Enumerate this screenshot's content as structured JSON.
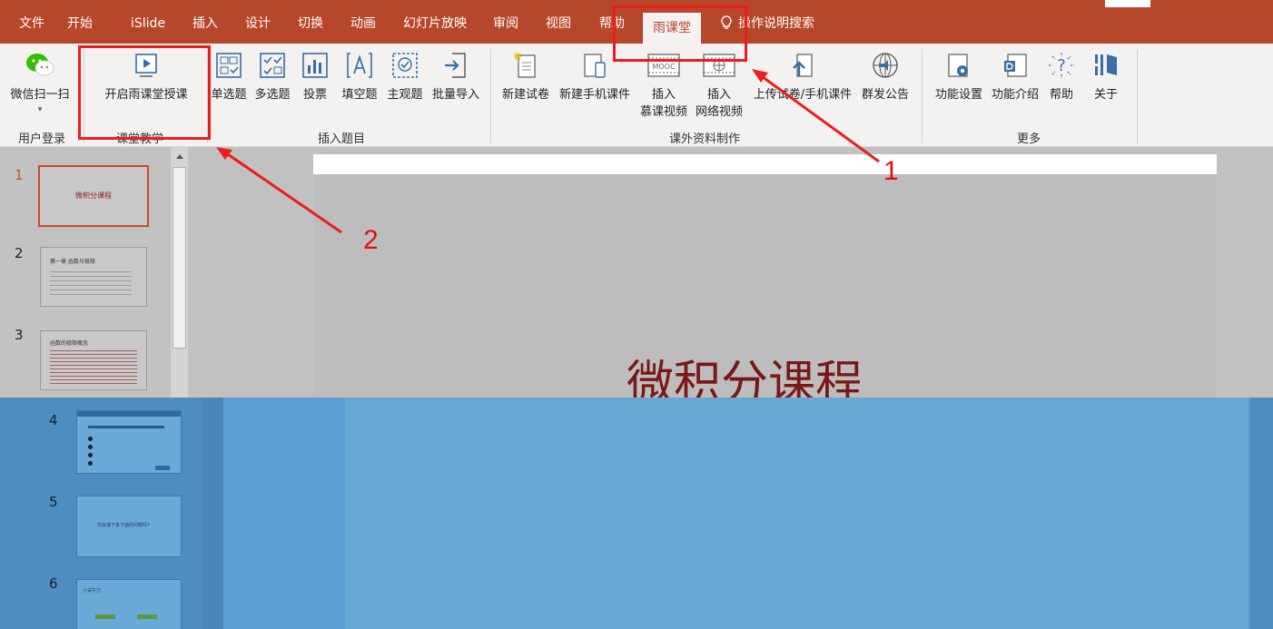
{
  "menu": {
    "tabs": [
      "文件",
      "开始",
      "iSlide",
      "插入",
      "设计",
      "切换",
      "动画",
      "幻灯片放映",
      "审阅",
      "视图",
      "帮助"
    ],
    "active_tab": "雨课堂",
    "tell_me": "操作说明搜索"
  },
  "ribbon": {
    "groups": {
      "login": "用户登录",
      "teaching": "课堂教学",
      "insert_questions": "插入题目",
      "materials": "课外资料制作",
      "more": "更多"
    },
    "buttons": {
      "wechat_scan": "微信扫一扫",
      "start_class": "开启雨课堂授课",
      "single_choice": "单选题",
      "multi_choice": "多选题",
      "vote": "投票",
      "fill_blank": "填空题",
      "subjective": "主观题",
      "batch_import": "批量导入",
      "new_exam": "新建试卷",
      "new_mobile": "新建手机课件",
      "insert_mooc_1": "插入",
      "insert_mooc_2": "慕课视频",
      "insert_web_1": "插入",
      "insert_web_2": "网络视频",
      "upload": "上传试卷/手机课件",
      "announce": "群发公告",
      "settings": "功能设置",
      "intro": "功能介绍",
      "help": "帮助",
      "about": "关于"
    },
    "mooc_text": "MOOC"
  },
  "slides": {
    "numbers": [
      "1",
      "2",
      "3",
      "4",
      "5",
      "6"
    ],
    "thumb1_title": "微积分课程",
    "thumb2_title": "第一章 函数与极限",
    "thumb3_title": "函数的极限概念",
    "thumb5_title": "你会接下来下面的问题吗？",
    "thumb6_title": "小试牛刀"
  },
  "main_slide": {
    "title": "微积分课程"
  },
  "annotations": {
    "one": "1",
    "two": "2"
  },
  "colors": {
    "accent": "#b7472a",
    "annotation": "#ef1c1c"
  }
}
